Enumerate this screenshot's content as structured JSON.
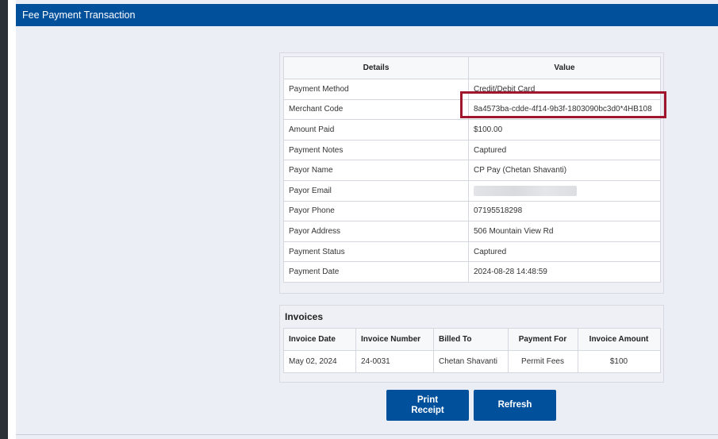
{
  "header": {
    "title": "Fee Payment Transaction"
  },
  "details_table": {
    "columns": [
      "Details",
      "Value"
    ],
    "rows": [
      {
        "label": "Payment Method",
        "value": "Credit/Debit Card"
      },
      {
        "label": "Merchant Code",
        "value": "8a4573ba-cdde-4f14-9b3f-1803090bc3d0*4HB108"
      },
      {
        "label": "Amount Paid",
        "value": "$100.00"
      },
      {
        "label": "Payment Notes",
        "value": "Captured"
      },
      {
        "label": "Payor Name",
        "value": "CP Pay (Chetan Shavanti)"
      },
      {
        "label": "Payor Email",
        "value": ""
      },
      {
        "label": "Payor Phone",
        "value": "07195518298"
      },
      {
        "label": "Payor Address",
        "value": "506 Mountain View Rd"
      },
      {
        "label": "Payment Status",
        "value": "Captured"
      },
      {
        "label": "Payment Date",
        "value": "2024-08-28 14:48:59"
      }
    ]
  },
  "invoices": {
    "title": "Invoices",
    "columns": [
      "Invoice Date",
      "Invoice Number",
      "Billed To",
      "Payment For",
      "Invoice Amount"
    ],
    "rows": [
      {
        "date": "May 02, 2024",
        "number": "24-0031",
        "billed_to": "Chetan Shavanti",
        "payment_for": "Permit Fees",
        "amount": "$100"
      }
    ]
  },
  "buttons": {
    "print_line1": "Print",
    "print_line2": "Receipt",
    "refresh": "Refresh"
  },
  "colors": {
    "header_bg": "#01509c",
    "highlight_border": "#a0162c",
    "page_bg": "#ebeef5"
  }
}
